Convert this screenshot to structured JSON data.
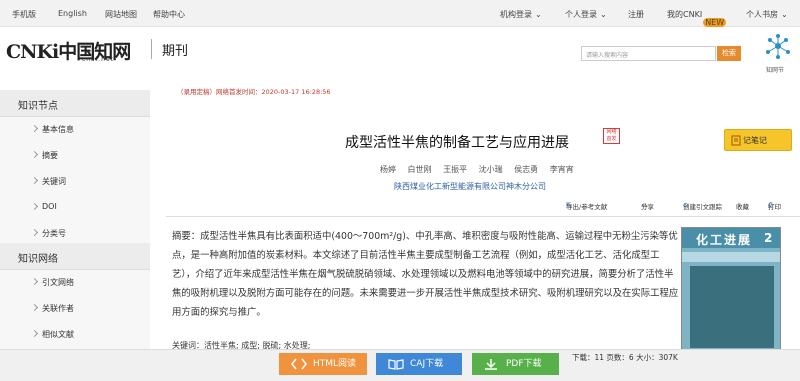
{
  "topbar": {
    "mobile": "手机版",
    "english": "English",
    "sitemap": "网站地图",
    "help": "帮助中心",
    "org_login": "机构登录",
    "personal_login": "个人登录",
    "register": "注册",
    "my_cnki": "我的CNKI",
    "new_badge": "NEW",
    "personal_library": "个人书房"
  },
  "header": {
    "logo_main": "CNKi中国知网",
    "logo_sub": "cnki.net",
    "section": "期刊",
    "search_placeholder": "请输入搜索内容",
    "search_btn": "检索",
    "zhiwang_label": "知网节"
  },
  "sidebar": {
    "section1": "知识节点",
    "items1": [
      "基本信息",
      "摘要",
      "关键词",
      "DOI",
      "分类号"
    ],
    "section2": "知识网络",
    "items2": [
      "引文网络",
      "关联作者",
      "相似文献"
    ]
  },
  "article": {
    "notice": "（录用定稿）网络首发时间：2020-03-17 16:28:56",
    "title": "成型活性半焦的制备工艺与应用进展",
    "title_badge": "网络首发",
    "note_btn": "记笔记",
    "authors": [
      "杨婷",
      "白世刚",
      "王振平",
      "沈小瑞",
      "侯志勇",
      "李宵宵"
    ],
    "org": "陕西煤业化工新型能源有限公司神木分公司",
    "tools": {
      "cite": "导出/参考文献",
      "share": "分享",
      "citation_track": "创建引文跟踪",
      "favorite": "收藏",
      "print": "打印"
    },
    "abstract": "摘要：成型活性半焦具有比表面积适中(400～700m²/g)、中孔率高、堆积密度与吸附性能高、运输过程中无粉尘污染等优点，是一种高附加值的炭素材料。本文综述了目前活性半焦主要成型制备工艺流程（例如，成型活化工艺、活化成型工艺），介绍了近年来成型活性半焦在烟气脱硫脱硝领域、水处理领域以及燃料电池等领域中的研究进展，简要分析了活性半焦的吸附机理以及脱附方面可能存在的问题。未来需要进一步开展活性半焦成型技术研究、吸附机理研究以及在实际工程应用方面的探究与推广。",
    "keywords": "关键词：活性半焦; 成型; 脱硫; 水处理;",
    "cover_title": "化工进展",
    "cover_issue": "2"
  },
  "downloads": {
    "html": "HTML阅读",
    "caj": "CAJ下载",
    "pdf": "PDF下载",
    "stats": "下载：11   页数：6   大小：307K"
  }
}
